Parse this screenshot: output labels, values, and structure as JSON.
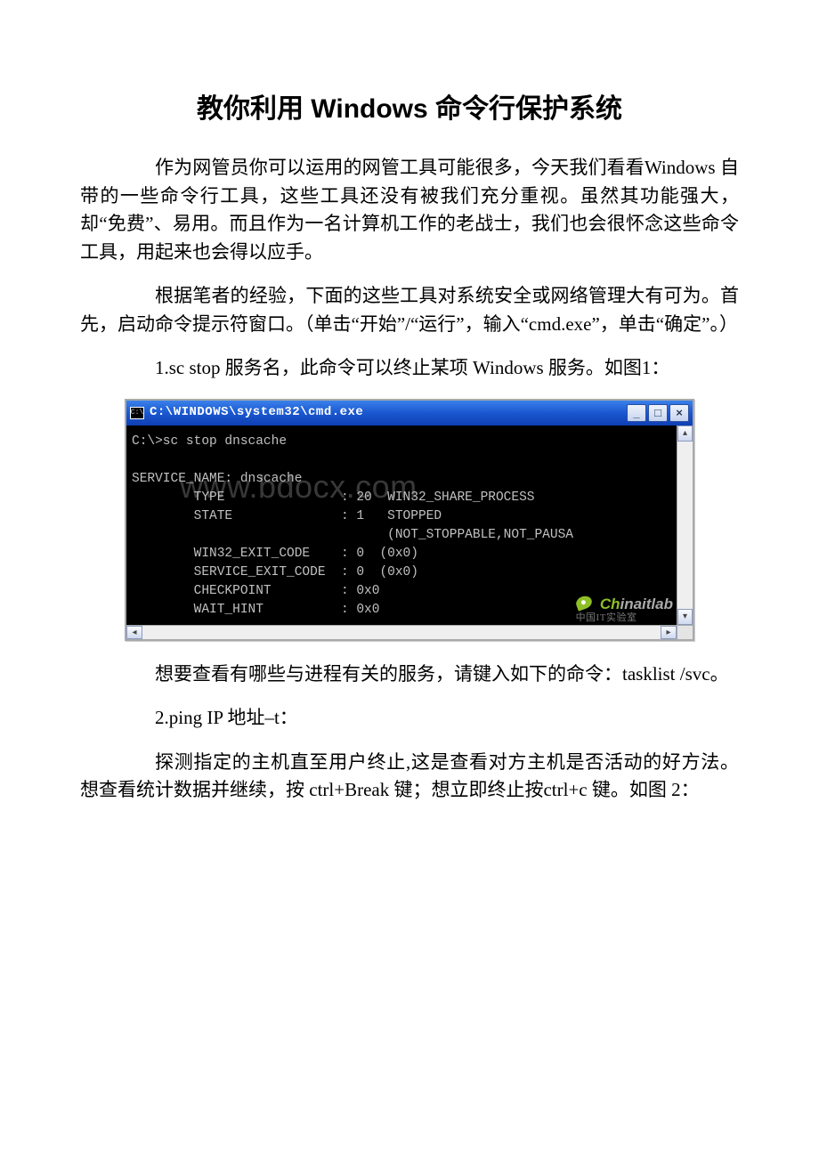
{
  "title": "教你利用 Windows 命令行保护系统",
  "para1": "作为网管员你可以运用的网管工具可能很多，今天我们看看Windows 自带的一些命令行工具，这些工具还没有被我们充分重视。虽然其功能强大，却“免费”、易用。而且作为一名计算机工作的老战士，我们也会很怀念这些命令工具，用起来也会得以应手。",
  "para2": "根据笔者的经验，下面的这些工具对系统安全或网络管理大有可为。首先，启动命令提示符窗口。（单击“开始”/“运行”，输入“cmd.exe”，单击“确定”。）",
  "para3": "1.sc stop 服务名，此命令可以终止某项 Windows 服务。如图1：",
  "para4": "想要查看有哪些与进程有关的服务，请键入如下的命令：tasklist /svc。",
  "para5": "2.ping IP 地址–t：",
  "para6": "探测指定的主机直至用户终止,这是查看对方主机是否活动的好方法。想查看统计数据并继续，按 ctrl+Break 键；想立即终止按ctrl+c 键。如图 2：",
  "cmd": {
    "title": "C:\\WINDOWS\\system32\\cmd.exe",
    "icon_label": "C:\\",
    "lines": "C:\\>sc stop dnscache\n\nSERVICE_NAME: dnscache\n        TYPE               : 20  WIN32_SHARE_PROCESS\n        STATE              : 1   STOPPED\n                                 (NOT_STOPPABLE,NOT_PAUSA\n        WIN32_EXIT_CODE    : 0  (0x0)\n        SERVICE_EXIT_CODE  : 0  (0x0)\n        CHECKPOINT         : 0x0\n        WAIT_HINT          : 0x0",
    "minimize": "_",
    "maximize": "□",
    "close": "×",
    "up": "▴",
    "down": "▾",
    "left": "◂",
    "right": "▸"
  },
  "watermark": "www.bdocx.com",
  "brand": {
    "top_green": "Ch",
    "top_gray": "inaitlab",
    "sub": "中国IT实验室"
  }
}
